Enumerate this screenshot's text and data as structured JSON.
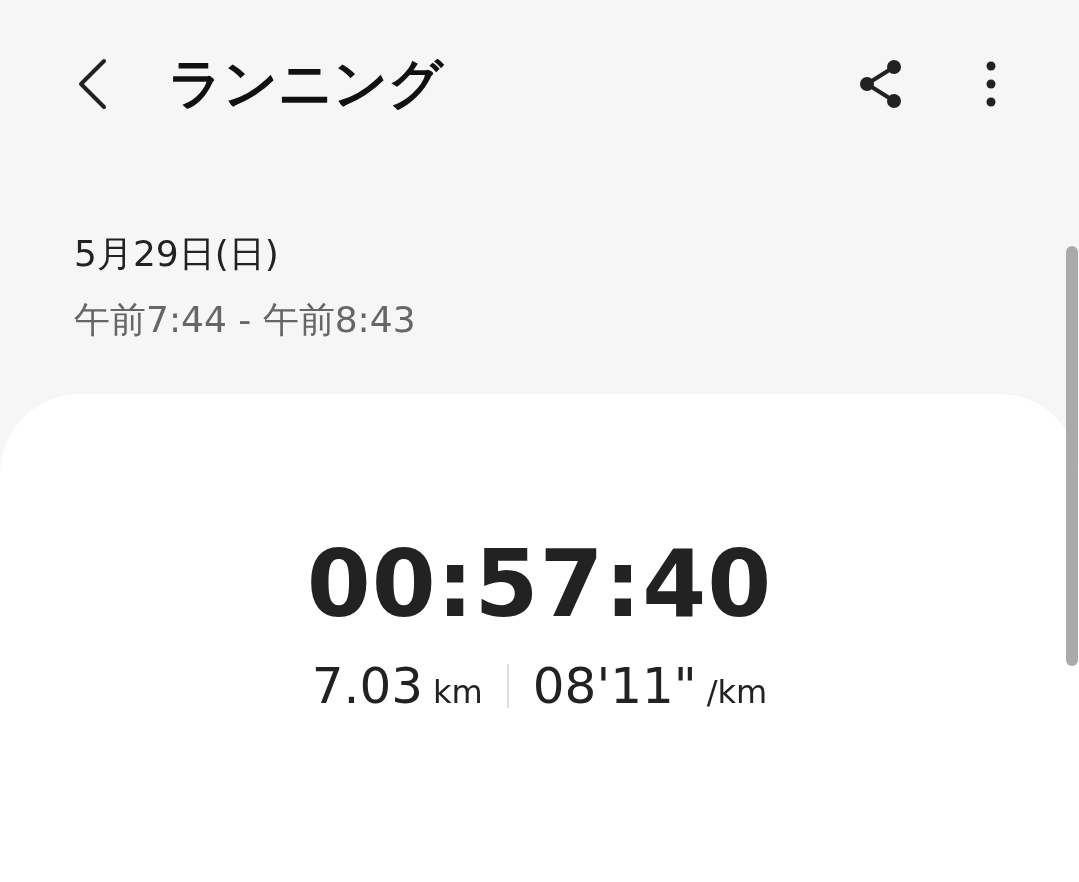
{
  "header": {
    "title": "ランニング"
  },
  "session": {
    "date": "5月29日(日)",
    "time_range": "午前7:44 - 午前8:43"
  },
  "summary": {
    "duration": "00:57:40",
    "stats": [
      {
        "value": "7.03",
        "unit": "km"
      },
      {
        "value": "08'11\"",
        "unit": "/km"
      }
    ]
  }
}
